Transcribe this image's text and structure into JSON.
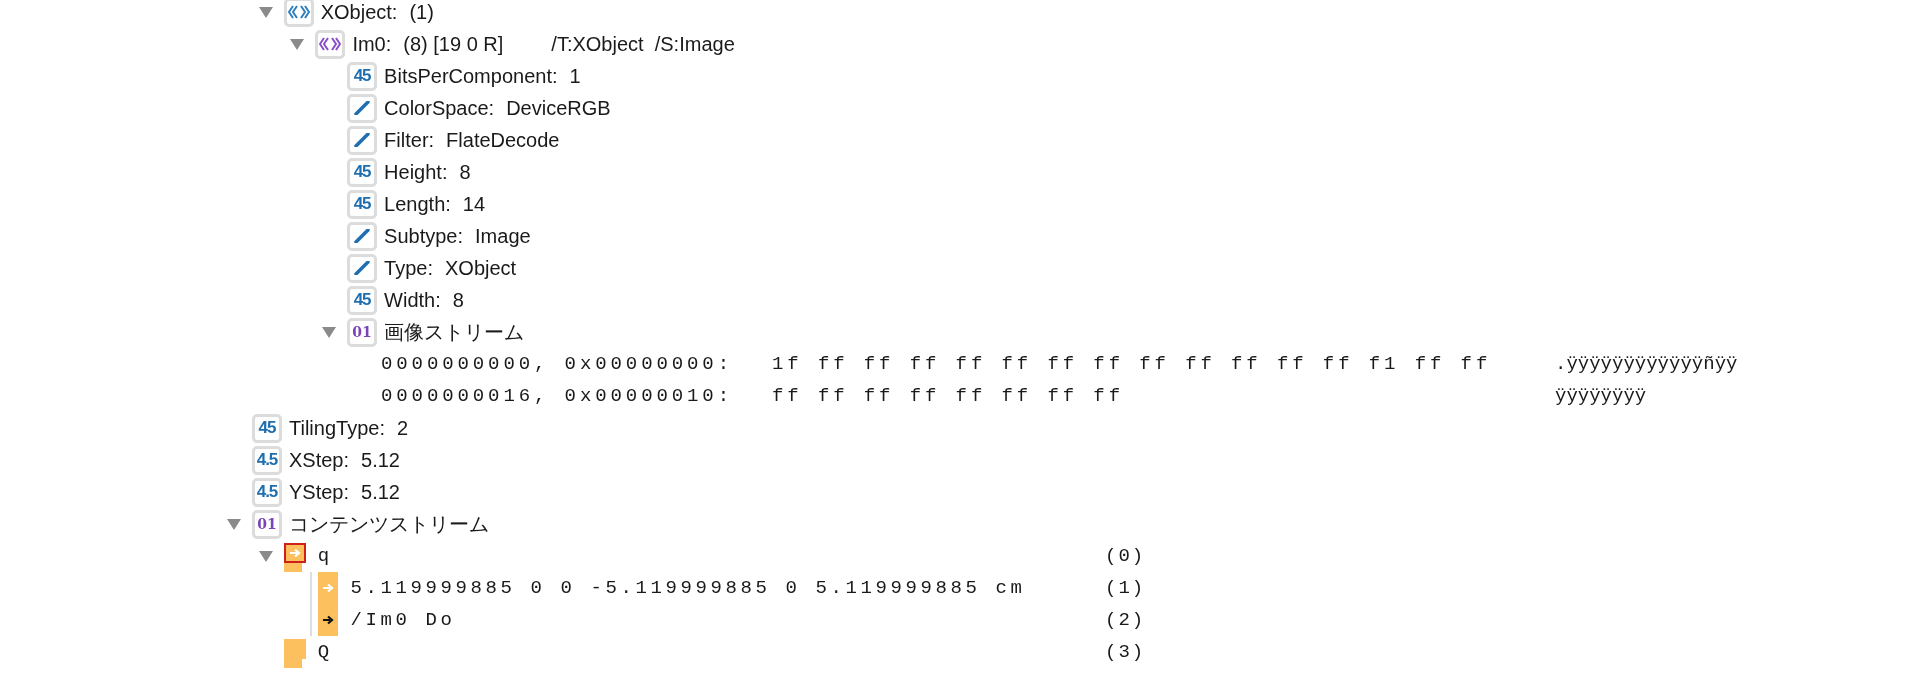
{
  "tree": {
    "scrolled_branch": [
      {
        "kind": "dict",
        "label": "XObject:",
        "value": "(1)",
        "expanded": true,
        "children": [
          {
            "kind": "stream-dict",
            "label": "Im0:",
            "value": "(8) [19 0 R]",
            "extra": "/T:XObject  /S:Image",
            "expanded": true,
            "children": [
              {
                "kind": "integer",
                "badge": "45",
                "label": "BitsPerComponent:",
                "value": "1"
              },
              {
                "kind": "name",
                "label": "ColorSpace:",
                "value": "DeviceRGB"
              },
              {
                "kind": "name",
                "label": "Filter:",
                "value": "FlateDecode"
              },
              {
                "kind": "integer",
                "badge": "45",
                "label": "Height:",
                "value": "8"
              },
              {
                "kind": "integer",
                "badge": "45",
                "label": "Length:",
                "value": "14"
              },
              {
                "kind": "name",
                "label": "Subtype:",
                "value": "Image"
              },
              {
                "kind": "name",
                "label": "Type:",
                "value": "XObject"
              },
              {
                "kind": "integer",
                "badge": "45",
                "label": "Width:",
                "value": "8"
              },
              {
                "kind": "stream",
                "badge": "01",
                "label": "画像ストリーム",
                "expanded": true,
                "hex": [
                  {
                    "offset": "0000000000, 0x00000000:",
                    "bytes": "1f ff ff ff ff ff ff ff ff ff ff ff ff f1 ff ff",
                    "ascii": ".ÿÿÿÿÿÿÿÿÿÿÿÿñÿÿ"
                  },
                  {
                    "offset": "0000000016, 0x00000010:",
                    "bytes": "ff ff ff ff ff ff ff ff",
                    "ascii": "ÿÿÿÿÿÿÿÿ"
                  }
                ]
              }
            ]
          }
        ]
      }
    ],
    "items": [
      {
        "kind": "integer",
        "badge": "45",
        "label": "TilingType:",
        "value": "2"
      },
      {
        "kind": "real",
        "badge": "4.5",
        "label": "XStep:",
        "value": "5.12"
      },
      {
        "kind": "real",
        "badge": "4.5",
        "label": "YStep:",
        "value": "5.12"
      },
      {
        "kind": "stream",
        "badge": "01",
        "label": "コンテンツストリーム",
        "expanded": true,
        "ops": [
          {
            "kind": "save",
            "text": "q",
            "index": "(0)",
            "selected": true,
            "expanded": true,
            "children": [
              {
                "kind": "state",
                "text": "5.119999885 0 0 -5.119999885 0 5.119999885 cm",
                "index": "(1)",
                "selected": false
              },
              {
                "kind": "paint",
                "text": "/Im0 Do",
                "index": "(2)",
                "selected": false
              }
            ]
          },
          {
            "kind": "restore",
            "text": "Q",
            "index": "(3)",
            "selected": false
          }
        ]
      }
    ]
  }
}
